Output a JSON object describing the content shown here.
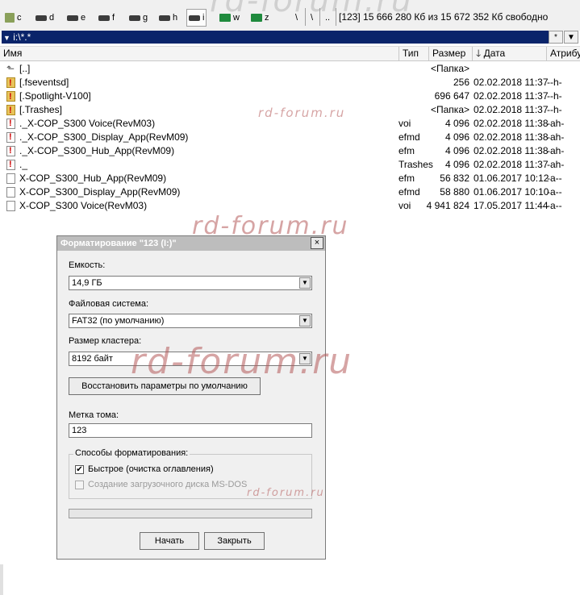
{
  "drives": [
    {
      "letter": "c",
      "type": "root"
    },
    {
      "letter": "d",
      "type": "disk"
    },
    {
      "letter": "e",
      "type": "disk"
    },
    {
      "letter": "f",
      "type": "disk"
    },
    {
      "letter": "g",
      "type": "disk"
    },
    {
      "letter": "h",
      "type": "disk"
    },
    {
      "letter": "i",
      "type": "disk",
      "active": true
    },
    {
      "letter": "w",
      "type": "net"
    },
    {
      "letter": "z",
      "type": "net"
    }
  ],
  "nav": {
    "root": "\\",
    "parent": ".."
  },
  "free_info": "[123]  15 666 280 Кб из 15 672 352 Кб свободно",
  "path": "i:\\*.*",
  "path_buttons": {
    "star": "*",
    "down": "▼"
  },
  "columns": {
    "name": "Имя",
    "ext": "Тип",
    "size": "Размер",
    "date": "Дата",
    "attr": "Атрибу"
  },
  "files": [
    {
      "icon": "up",
      "name": "[..]",
      "ext": "",
      "size": "<Папка>",
      "date": "",
      "attr": ""
    },
    {
      "icon": "hidden",
      "name": "[.fseventsd]",
      "ext": "",
      "size": "256",
      "date": "02.02.2018 11:37",
      "attr": "--h-"
    },
    {
      "icon": "hidden",
      "name": "[.Spotlight-V100]",
      "ext": "",
      "size": "696 647",
      "date": "02.02.2018 11:37",
      "attr": "--h-"
    },
    {
      "icon": "hidden",
      "name": "[.Trashes]",
      "ext": "",
      "size": "<Папка>",
      "date": "02.02.2018 11:37",
      "attr": "--h-"
    },
    {
      "icon": "hiddenfile",
      "name": "._X-COP_S300 Voice(RevM03)",
      "ext": "voi",
      "size": "4 096",
      "date": "02.02.2018 11:38",
      "attr": "-ah-"
    },
    {
      "icon": "hiddenfile",
      "name": "._X-COP_S300_Display_App(RevM09)",
      "ext": "efmd",
      "size": "4 096",
      "date": "02.02.2018 11:38",
      "attr": "-ah-"
    },
    {
      "icon": "hiddenfile",
      "name": "._X-COP_S300_Hub_App(RevM09)",
      "ext": "efm",
      "size": "4 096",
      "date": "02.02.2018 11:38",
      "attr": "-ah-"
    },
    {
      "icon": "hiddenfile",
      "name": "._",
      "ext": "Trashes",
      "size": "4 096",
      "date": "02.02.2018 11:37",
      "attr": "-ah-"
    },
    {
      "icon": "file",
      "name": "X-COP_S300_Hub_App(RevM09)",
      "ext": "efm",
      "size": "56 832",
      "date": "01.06.2017 10:12",
      "attr": "-a--"
    },
    {
      "icon": "file",
      "name": "X-COP_S300_Display_App(RevM09)",
      "ext": "efmd",
      "size": "58 880",
      "date": "01.06.2017 10:10",
      "attr": "-a--"
    },
    {
      "icon": "file",
      "name": "X-COP_S300 Voice(RevM03)",
      "ext": "voi",
      "size": "4 941 824",
      "date": "17.05.2017 11:44",
      "attr": "-a--"
    }
  ],
  "dialog": {
    "title": "Форматирование \"123 (I:)\"",
    "close": "×",
    "capacity_label": "Емкость:",
    "capacity_value": "14,9 ГБ",
    "fs_label": "Файловая система:",
    "fs_value": "FAT32 (по умолчанию)",
    "cluster_label": "Размер кластера:",
    "cluster_value": "8192 байт",
    "restore_button": "Восстановить параметры по умолчанию",
    "volume_label": "Метка тома:",
    "volume_value": "123",
    "format_options_title": "Способы форматирования:",
    "quick_format": "Быстрое (очистка оглавления)",
    "quick_format_checked": true,
    "msdos_boot": "Создание загрузочного диска MS-DOS",
    "msdos_boot_checked": false,
    "progress": 0,
    "start_button": "Начать",
    "close_button": "Закрыть"
  },
  "watermark": "rd-forum.ru"
}
